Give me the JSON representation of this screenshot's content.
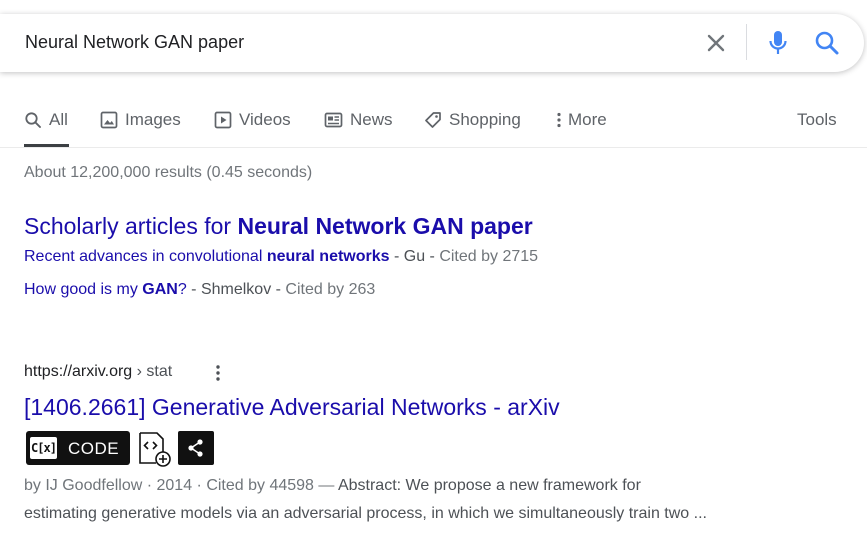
{
  "search": {
    "query": "Neural Network GAN paper"
  },
  "tabs": [
    {
      "label": "All",
      "icon": "search-icon",
      "active": true
    },
    {
      "label": "Images",
      "icon": "image-icon"
    },
    {
      "label": "Videos",
      "icon": "video-icon"
    },
    {
      "label": "News",
      "icon": "news-icon"
    },
    {
      "label": "Shopping",
      "icon": "tag-icon"
    },
    {
      "label": "More",
      "icon": "kebab-icon"
    }
  ],
  "tools_label": "Tools",
  "result_stats": "About 12,200,000 results (0.45 seconds)",
  "scholarly": {
    "title_prefix": "Scholarly articles for ",
    "title_bold": "Neural Network GAN paper",
    "items": [
      {
        "link_pre": "Recent advances in convolutional ",
        "link_bold": "neural networks",
        "link_post": "",
        "author": " - Gu - ",
        "cited": "Cited by 2715"
      },
      {
        "link_pre": "How good is my ",
        "link_bold": "GAN",
        "link_post": "?",
        "author": " - Shmelkov - ",
        "cited": "Cited by 263"
      }
    ]
  },
  "result": {
    "url": "https://arxiv.org",
    "breadcrumb": " › stat",
    "title": "[1406.2661] Generative Adversarial Networks - arXiv",
    "ext_cx_label": "C[x]",
    "ext_code_label": "CODE",
    "meta": "by IJ Goodfellow · 2014 · Cited by 44598 — ",
    "snippet_1": "Abstract: We propose a new framework for",
    "snippet_2": "estimating generative models via an adversarial process, in which we simultaneously train two ..."
  },
  "colors": {
    "link": "#1a0dab",
    "muted": "#70757a",
    "icon": "#5f6368",
    "accent_blue": "#4285f4"
  }
}
